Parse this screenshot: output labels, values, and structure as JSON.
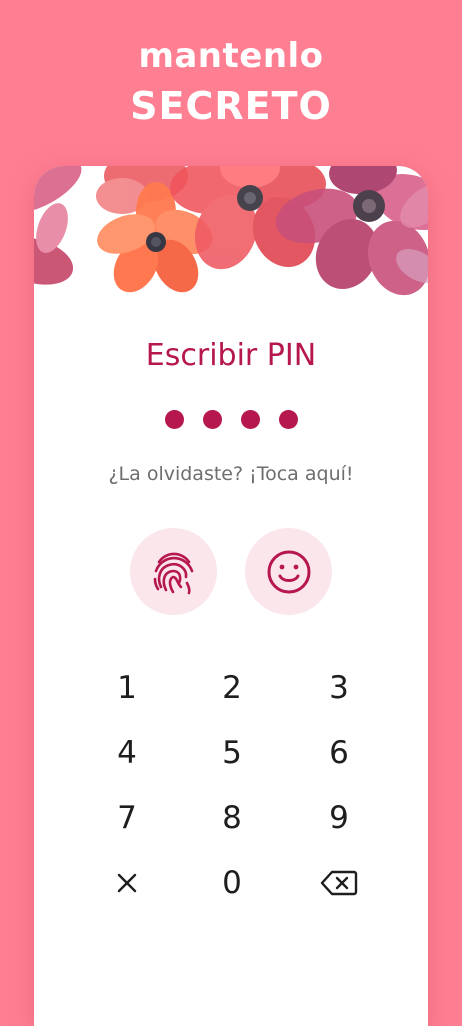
{
  "headline": {
    "line1": "mantenlo",
    "line2": "SECRETO"
  },
  "lock": {
    "title": "Escribir PIN",
    "pin_length_entered": 4,
    "forgot_text": "¿La olvidaste? ¡Toca aquí!"
  },
  "biometrics": {
    "fingerprint_icon": "fingerprint-icon",
    "face_icon": "smiley-face-icon"
  },
  "keypad": {
    "k1": "1",
    "k2": "2",
    "k3": "3",
    "k4": "4",
    "k5": "5",
    "k6": "6",
    "k7": "7",
    "k8": "8",
    "k9": "9",
    "k0": "0",
    "clear_icon": "close-icon",
    "backspace_icon": "backspace-icon"
  },
  "colors": {
    "background": "#ff7f92",
    "accent": "#b5174e",
    "bio_button_bg": "#fbe6ec",
    "card": "#ffffff"
  }
}
